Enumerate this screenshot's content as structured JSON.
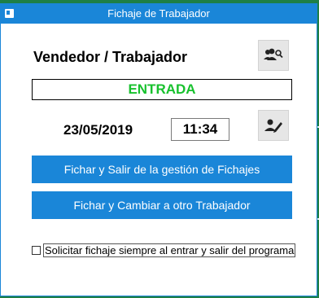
{
  "window": {
    "title": "Fichaje de Trabajador"
  },
  "worker": {
    "label": "Vendedor / Trabajador"
  },
  "status": {
    "text": "ENTRADA",
    "color": "#17c12d"
  },
  "datetime": {
    "date": "23/05/2019",
    "time": "11:34"
  },
  "buttons": {
    "fichar_salir": "Fichar y Salir de la gestión de Fichajes",
    "fichar_cambiar": "Fichar y Cambiar a otro Trabajador"
  },
  "options": {
    "solicitar_label": "Solicitar fichaje siempre al entrar y salir del programa",
    "solicitar_checked": false
  },
  "icons": {
    "search_users": "users-search-icon",
    "edit_user": "user-edit-icon"
  },
  "colors": {
    "accent": "#1a86d8",
    "background": "#1e7f46"
  }
}
